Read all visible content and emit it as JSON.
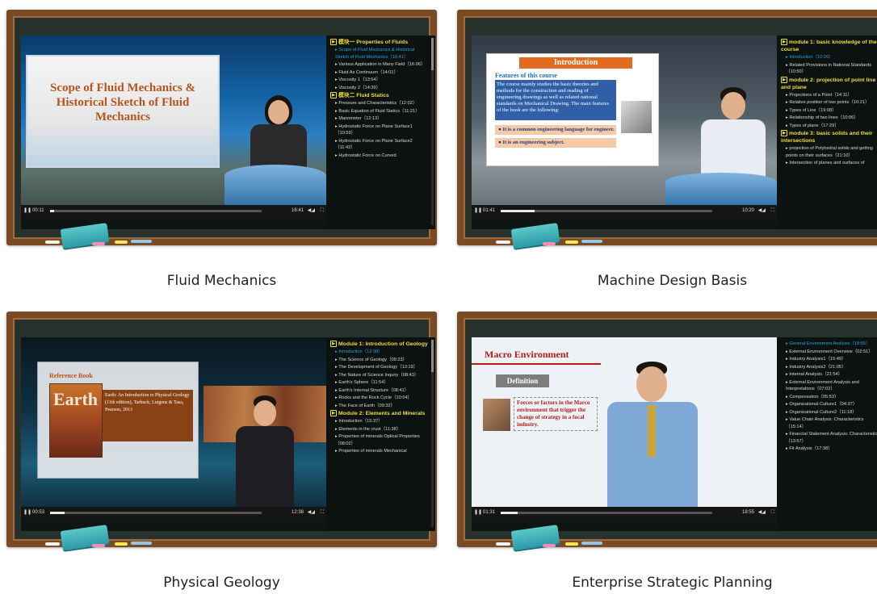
{
  "courses": [
    {
      "caption": "Fluid Mechanics",
      "slide": {
        "title": "Scope of Fluid Mechanics & Historical Sketch of Fluid Mechanics"
      },
      "player": {
        "current": "00:11",
        "total": "16:41",
        "progress": 0.02
      },
      "playlist": [
        {
          "type": "module",
          "text": "模块一 Properties of Fluids"
        },
        {
          "type": "lesson",
          "text": "Scope of Fluid Mechanics & Historical Sketch of Fluid Mechanics（16:41）",
          "active": true
        },
        {
          "type": "lesson",
          "text": "Various Application in Many Field（16:06）"
        },
        {
          "type": "lesson",
          "text": "Fluid As Continuum（14:01）"
        },
        {
          "type": "lesson",
          "text": "Viscosity 1（13:54）"
        },
        {
          "type": "lesson",
          "text": "Viscosity 2（14:39）"
        },
        {
          "type": "module",
          "text": "模块二 Fluid Statics"
        },
        {
          "type": "lesson",
          "text": "Pressure and Characteristics（12:02）"
        },
        {
          "type": "lesson",
          "text": "Basic Equation of Fluid Statics（11:21）"
        },
        {
          "type": "lesson",
          "text": "Manometer（12:13）"
        },
        {
          "type": "lesson",
          "text": "Hydrostatic Force on Plane Surface1（10:59）"
        },
        {
          "type": "lesson",
          "text": "Hydrostatic Force on Plane Surface2（11:42）"
        },
        {
          "type": "lesson",
          "text": "Hydrostatic Force on Curved"
        }
      ]
    },
    {
      "caption": "Machine Design Basis",
      "slide": {
        "tab": "Introduction",
        "heading": "Features of this course",
        "body": "The course mainly studies the basic theories and methods for the construction and reading of engineering drawings as well as related national standards on Mechanical Drawing. The main features of the book are the following:",
        "item1": "● It is a common engineering language for engineer.",
        "item2": "● It is an engineering subject."
      },
      "player": {
        "current": "01:41",
        "total": "10:20",
        "progress": 0.16
      },
      "playlist": [
        {
          "type": "module",
          "text": "module 1: basic knowledge of the course"
        },
        {
          "type": "lesson",
          "text": "Introduction（10:20）",
          "active": true
        },
        {
          "type": "lesson",
          "text": "Related Provisions in National Standards（10:50）"
        },
        {
          "type": "module",
          "text": "module 2: projection of point line and plane"
        },
        {
          "type": "lesson",
          "text": "Projections of a Point（14:11）"
        },
        {
          "type": "lesson",
          "text": "Relative position of two points（10:21）"
        },
        {
          "type": "lesson",
          "text": "Types of Line（19:08）"
        },
        {
          "type": "lesson",
          "text": "Relationship of two lines（10:06）"
        },
        {
          "type": "lesson",
          "text": "Types of plane（17:29）"
        },
        {
          "type": "module",
          "text": "module 3: basic solids and their intersections"
        },
        {
          "type": "lesson",
          "text": "projection of Polyhedral solids and getting points on their surfaces（21:10）"
        },
        {
          "type": "lesson",
          "text": "Intersection of planes and surfaces of"
        }
      ]
    },
    {
      "caption": "Physical Geology",
      "slide": {
        "ref": "Reference Book",
        "book": "Earth",
        "desc": "Earth: An Introduction to Physical Geology (11th edition), Tarbuck, Lutgens & Tasa, Pearson, 2013"
      },
      "player": {
        "current": "00:53",
        "total": "12:38",
        "progress": 0.07
      },
      "playlist": [
        {
          "type": "module",
          "text": "Module 1: Introduction of Geology"
        },
        {
          "type": "lesson",
          "text": "Introduction（12:38）",
          "active": true
        },
        {
          "type": "lesson",
          "text": "The Science of Geology（09:23）"
        },
        {
          "type": "lesson",
          "text": "The Development of Geology（13:19）"
        },
        {
          "type": "lesson",
          "text": "The Nature of Science Inquiry（08:43）"
        },
        {
          "type": "lesson",
          "text": "Earth's Sphere（11:54）"
        },
        {
          "type": "lesson",
          "text": "Earth's Internal Structure（08:41）"
        },
        {
          "type": "lesson",
          "text": "Rocks and the Rock Cycle（10:04）"
        },
        {
          "type": "lesson",
          "text": "The Face of Earth（09:32）"
        },
        {
          "type": "module",
          "text": "Module 2: Elements and Minerals"
        },
        {
          "type": "lesson",
          "text": "Introduction（15:37）"
        },
        {
          "type": "lesson",
          "text": "Elements in the crust（11:38）"
        },
        {
          "type": "lesson",
          "text": "Properties of minerals Optical Properties（08:02）"
        },
        {
          "type": "lesson",
          "text": "Properties of minerals Mechanical"
        }
      ]
    },
    {
      "caption": "Enterprise Strategic Planning",
      "slide": {
        "title": "Macro Environment",
        "badge": "Definition",
        "text": "Forces or factors in the Marco environment that trigger the change of strategy in a focal industry."
      },
      "player": {
        "current": "01:31",
        "total": "18:55",
        "progress": 0.08
      },
      "playlist": [
        {
          "type": "lesson",
          "text": "General Environment Analysis（18:55）",
          "active": true
        },
        {
          "type": "lesson",
          "text": "External Environment Overview（02:51）"
        },
        {
          "type": "lesson",
          "text": "Industry Analysis1（15:49）"
        },
        {
          "type": "lesson",
          "text": "Industry Analysis2（21:05）"
        },
        {
          "type": "lesson",
          "text": "Internal Analysis（21:54）"
        },
        {
          "type": "lesson",
          "text": "External Environment Analysis and Interpretations（07:02）"
        },
        {
          "type": "lesson",
          "text": "Compensation（05:53）"
        },
        {
          "type": "lesson",
          "text": "Organizational Culture1（04:37）"
        },
        {
          "type": "lesson",
          "text": "Organizational Culture2（11:18）"
        },
        {
          "type": "lesson",
          "text": "Value Chain Analysis: Characteristics（15:14）"
        },
        {
          "type": "lesson",
          "text": "Financial Statement Analysis: Characteristics（13:57）"
        },
        {
          "type": "lesson",
          "text": "Fit Analysis（17:38）"
        }
      ]
    }
  ],
  "colors": {
    "frame": "#7a4a25",
    "board": "#27322d",
    "module": "#f0de35",
    "active_lesson": "#1fa2e6"
  }
}
